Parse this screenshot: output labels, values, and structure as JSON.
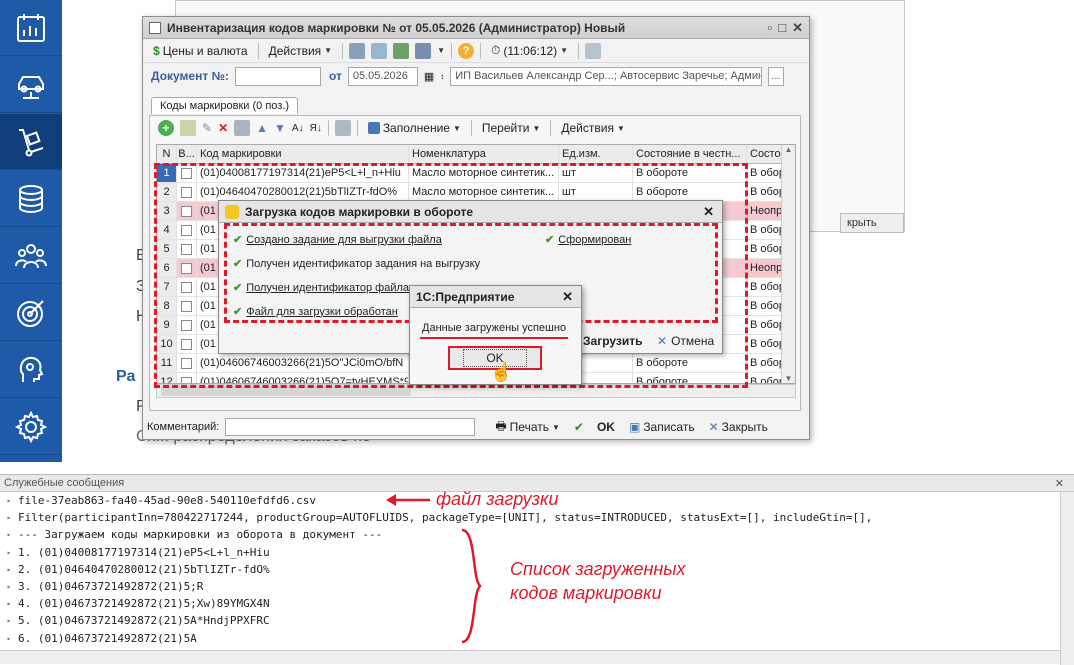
{
  "sidebar": {
    "items": [
      {
        "icon": "calendar-chart-icon"
      },
      {
        "icon": "car-lift-icon"
      },
      {
        "icon": "hand-truck-icon"
      },
      {
        "icon": "coins-icon"
      },
      {
        "icon": "team-icon"
      },
      {
        "icon": "target-icon"
      },
      {
        "icon": "head-icon"
      },
      {
        "icon": "gear-icon"
      }
    ],
    "active_index": 2
  },
  "background": {
    "closeButton": "крыть",
    "letters": [
      "Е",
      "З",
      "Н"
    ],
    "heading": "Ра",
    "para1": "Р",
    "para2": "Сх... распределения заказов по"
  },
  "window": {
    "title": "Инвентаризация кодов маркировки №  от 05.05.2026 (Администратор) Новый",
    "toolbar": {
      "prices": "Цены и валюта",
      "actions": "Действия",
      "time": "(11:06:12)"
    },
    "document": {
      "label": "Документ №:",
      "number": "",
      "from_label": "от",
      "date": "05.05.2026",
      "org": "ИП Васильев Александр Сер...; Автосервис Заречье; Админ"
    },
    "tab": "Коды маркировки (0 поз.)",
    "table_toolbar": {
      "fill": "Заполнение",
      "goto": "Перейти",
      "actions": "Действия"
    },
    "columns": [
      "N",
      "В...",
      "Код маркировки",
      "Номенклатура",
      "Ед.изм.",
      "Состояние в честн...",
      "Состо"
    ],
    "rows": [
      {
        "n": "1",
        "code": "(01)04008177197314(21)eP5<L+l_n+Hiu",
        "nom": "Масло моторное синтетик...",
        "ed": "шт",
        "st": "В обороте",
        "st2": "В оборо",
        "pink": false,
        "sel": true
      },
      {
        "n": "2",
        "code": "(01)04640470280012(21)5bTlIZTr-fdO%",
        "nom": "Масло моторное синтетик...",
        "ed": "шт",
        "st": "В обороте",
        "st2": "В оборо",
        "pink": false,
        "sel": false
      },
      {
        "n": "3",
        "code": "(01",
        "nom": "",
        "ed": "",
        "st": "",
        "st2": "Неопр",
        "pink": true,
        "sel": false
      },
      {
        "n": "4",
        "code": "(01",
        "nom": "",
        "ed": "",
        "st": "",
        "st2": "В оборо",
        "pink": false,
        "sel": false
      },
      {
        "n": "5",
        "code": "(01",
        "nom": "",
        "ed": "",
        "st": "",
        "st2": "В оборо",
        "pink": false,
        "sel": false
      },
      {
        "n": "6",
        "code": "(01",
        "nom": "",
        "ed": "",
        "st": "",
        "st2": "Неопр",
        "pink": true,
        "sel": false
      },
      {
        "n": "7",
        "code": "(01",
        "nom": "",
        "ed": "",
        "st": "",
        "st2": "В оборо",
        "pink": false,
        "sel": false
      },
      {
        "n": "8",
        "code": "(01",
        "nom": "",
        "ed": "",
        "st": "",
        "st2": "В оборо",
        "pink": false,
        "sel": false
      },
      {
        "n": "9",
        "code": "(01",
        "nom": "",
        "ed": "",
        "st": "",
        "st2": "В оборо",
        "pink": false,
        "sel": false
      },
      {
        "n": "10",
        "code": "(01",
        "nom": "",
        "ed": "",
        "st": "",
        "st2": "В оборо",
        "pink": false,
        "sel": false
      },
      {
        "n": "11",
        "code": "(01)04606746003266(21)5O\"JCi0mO/bfN",
        "nom": "",
        "ed": "",
        "st": "В обороте",
        "st2": "В оборо",
        "pink": false,
        "sel": false
      },
      {
        "n": "12",
        "code": "(01)04606746003266(21)5O7=tvHEYMS*9",
        "nom": "",
        "ed": "",
        "st": "В обороте",
        "st2": "В оборо",
        "pink": false,
        "sel": false
      }
    ],
    "comment_label": "Комментарий:",
    "print": "Печать",
    "ok": "OK",
    "save": "Записать",
    "close": "Закрыть"
  },
  "load_dialog": {
    "title": "Загрузка кодов маркировки в обороте",
    "items": [
      "Создано задание для выгрузки файла",
      "Получен идентификатор задания на выгрузку",
      "Получен идентификатор файла",
      "Файл для загрузки обработан"
    ],
    "formed": "Сформирован",
    "load_btn": "Загрузить",
    "cancel_btn": "Отмена"
  },
  "message_box": {
    "title": "1С:Предприятие",
    "text": "Данные загружены успешно",
    "ok": "OK"
  },
  "service": {
    "title": "Служебные сообщения",
    "lines": [
      "file-37eab863-fa40-45ad-90e8-540110efdfd6.csv",
      "Filter(participantInn=780422717244, productGroup=AUTOFLUIDS, packageType=[UNIT], status=INTRODUCED, statusExt=[], includeGtin=[],",
      "--- Загружаем коды маркировки из оборота в документ ---",
      "1. (01)04008177197314(21)eP5<L+l_n+Hiu",
      "2. (01)04640470280012(21)5bTlIZTr-fdO%",
      "3. (01)04673721492872(21)5;R",
      "4. (01)04673721492872(21)5;Xw)89YMGX4N",
      "5. (01)04673721492872(21)5A*HndjPPXFRC",
      "6. (01)04673721492872(21)5A"
    ]
  },
  "annotations": {
    "file_label": "файл загрузки",
    "list_label_1": "Список загруженных",
    "list_label_2": "кодов маркировки"
  },
  "colors": {
    "sidebar": "#1e5aa8",
    "highlight": "#e0192a",
    "pink_row": "#f6c9d1",
    "check": "#3c9b2a"
  }
}
